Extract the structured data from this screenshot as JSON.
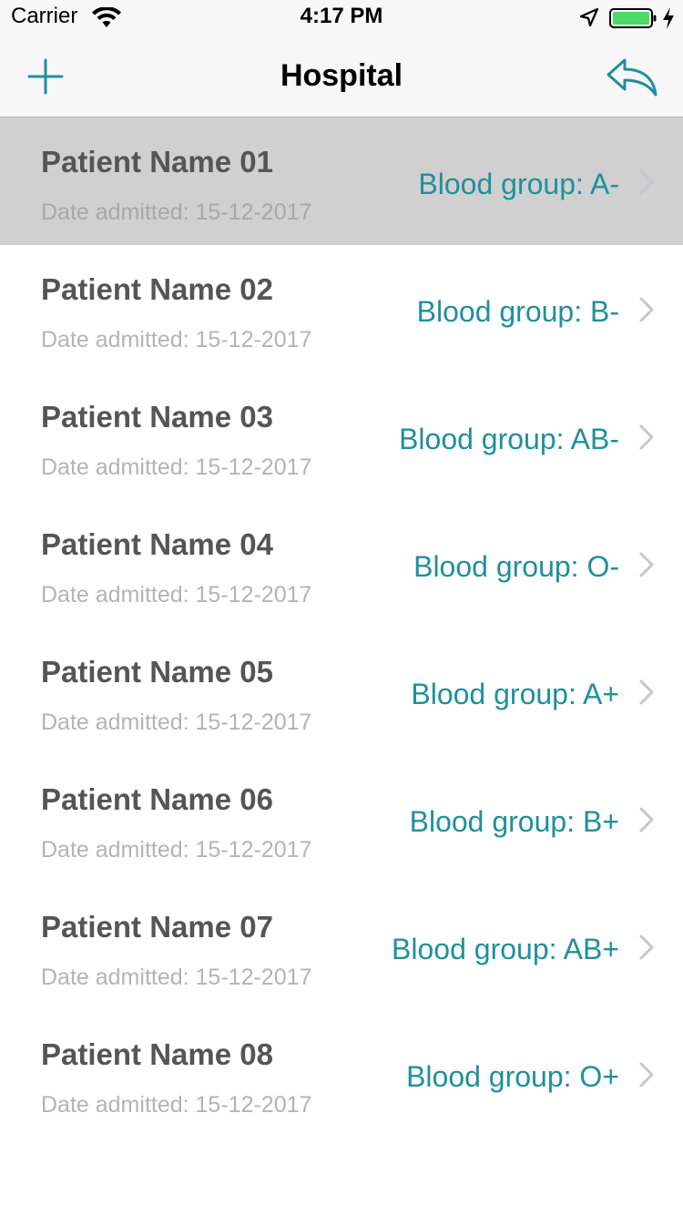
{
  "status_bar": {
    "carrier": "Carrier",
    "time": "4:17 PM",
    "icons": [
      "wifi-icon",
      "location-arrow-icon",
      "battery-icon",
      "charging-bolt-icon"
    ]
  },
  "nav": {
    "title": "Hospital",
    "left_icon": "plus-icon",
    "right_icon": "reply-icon"
  },
  "colors": {
    "accent": "#20909a",
    "battery": "#4cd964",
    "selected_row": "#d0d0d0",
    "name_text": "#555555",
    "date_text": "#b4b4b4"
  },
  "patients": [
    {
      "name": "Patient Name 01",
      "date": "Date admitted: 15-12-2017",
      "blood": "Blood group: A-",
      "selected": true
    },
    {
      "name": "Patient Name 02",
      "date": "Date admitted: 15-12-2017",
      "blood": "Blood group: B-"
    },
    {
      "name": "Patient Name 03",
      "date": "Date admitted: 15-12-2017",
      "blood": "Blood group: AB-"
    },
    {
      "name": "Patient Name 04",
      "date": "Date admitted: 15-12-2017",
      "blood": "Blood group: O-"
    },
    {
      "name": "Patient Name 05",
      "date": "Date admitted: 15-12-2017",
      "blood": "Blood group: A+"
    },
    {
      "name": "Patient Name 06",
      "date": "Date admitted: 15-12-2017",
      "blood": "Blood group: B+"
    },
    {
      "name": "Patient Name 07",
      "date": "Date admitted: 15-12-2017",
      "blood": "Blood group: AB+"
    },
    {
      "name": "Patient Name 08",
      "date": "Date admitted: 15-12-2017",
      "blood": "Blood group: O+"
    }
  ]
}
